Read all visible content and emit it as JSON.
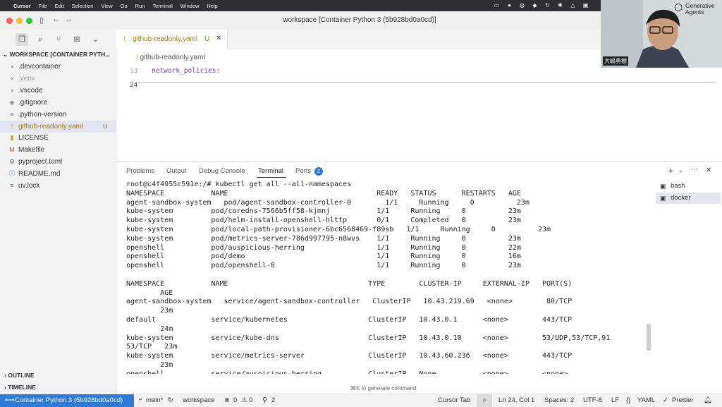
{
  "menubar": {
    "items": [
      "Cursor",
      "File",
      "Edit",
      "Selection",
      "View",
      "Go",
      "Run",
      "Terminal",
      "Window",
      "Help"
    ]
  },
  "window": {
    "title": "workspace [Container Python 3 (5b928bd0a0cd)]"
  },
  "explorer": {
    "workspace_label": "WORKSPACE [CONTAINER PYTH...",
    "items": [
      {
        "label": ".devcontainer",
        "icon": "chevron-right-icon"
      },
      {
        "label": ".venv",
        "icon": "chevron-right-icon"
      },
      {
        "label": ".vscode",
        "icon": "chevron-right-icon"
      },
      {
        "label": ".gitignore",
        "icon": "gitignore-icon"
      },
      {
        "label": ".python-version",
        "icon": "file-lines-icon"
      },
      {
        "label": "github-readonly.yaml",
        "icon": "yaml-icon",
        "status": "U"
      },
      {
        "label": "LICENSE",
        "icon": "license-icon"
      },
      {
        "label": "Makefile",
        "icon": "makefile-icon"
      },
      {
        "label": "pyproject.toml",
        "icon": "gear-icon"
      },
      {
        "label": "README.md",
        "icon": "info-icon"
      },
      {
        "label": "uv.lock",
        "icon": "file-lines-icon"
      }
    ],
    "outline_label": "OUTLINE",
    "timeline_label": "TIMELINE"
  },
  "editor": {
    "tab": {
      "label": "github-readonly.yaml",
      "status": "U"
    },
    "breadcrumb": "github-readonly.yaml",
    "lines": [
      {
        "num": "13",
        "text": "network_policies:"
      },
      {
        "num": "24",
        "text": ""
      }
    ]
  },
  "panel": {
    "tabs": [
      "Problems",
      "Output",
      "Debug Console",
      "Terminal",
      "Ports"
    ],
    "ports_badge": "2",
    "terminal_lines": [
      "root@c4f4955c591e:/# kubectl get all --all-namespaces",
      "NAMESPACE           NAME                                   READY   STATUS      RESTARTS   AGE",
      "agent-sandbox-system   pod/agent-sandbox-controller-0        1/1     Running     0          23m",
      "kube-system         pod/coredns-7566b5ff58-kjmnj           1/1     Running     0          23m",
      "kube-system         pod/helm-install-openshell-hlttp       0/1     Completed   0          23m",
      "kube-system         pod/local-path-provisioner-6bc6568469-f89sb   1/1     Running     0          23m",
      "kube-system         pod/metrics-server-786d997795-n8wvs    1/1     Running     0          23m",
      "openshell           pod/auspicious-herring                 1/1     Running     0          22m",
      "openshell           pod/demo                               1/1     Running     0          16m",
      "openshell           pod/openshell-0                        1/1     Running     0          23m",
      "",
      "NAMESPACE           NAME                                 TYPE        CLUSTER-IP     EXTERNAL-IP   PORT(S)",
      "        AGE",
      "agent-sandbox-system   service/agent-sandbox-controller   ClusterIP   10.43.219.69   <none>        80/TCP",
      "        23m",
      "default             service/kubernetes                   ClusterIP   10.43.0.1      <none>        443/TCP",
      "        24m",
      "kube-system         service/kube-dns                     ClusterIP   10.43.0.10     <none>        53/UDP,53/TCP,91",
      "53/TCP   23m",
      "kube-system         service/metrics-server               ClusterIP   10.43.60.236   <none>        443/TCP",
      "        23m",
      "openshell           service/auspicious-herring           ClusterIP   None           <none>        <none>"
    ],
    "sessions": [
      "bash",
      "docker"
    ],
    "hint": "⌘K to generate command"
  },
  "statusbar": {
    "remote": "Container Python 3 (5b928bd0a0cd)",
    "branch": "main*",
    "folder": "workspace",
    "errors": "0",
    "warnings": "0",
    "ports": "2",
    "cursor_tab": "Cursor Tab",
    "position": "Ln 24, Col 1",
    "spaces": "Spaces: 2",
    "encoding": "UTF-8",
    "eol": "LF",
    "language": "YAML",
    "prettier": "Prettier"
  },
  "webcam": {
    "logo_text": "Generative Agents",
    "name_label": "大嶋勇樹"
  },
  "colors": {
    "remote_bg": "#2d7bd6",
    "selection": "#e4e6f1",
    "untracked": "#9a7b18"
  }
}
